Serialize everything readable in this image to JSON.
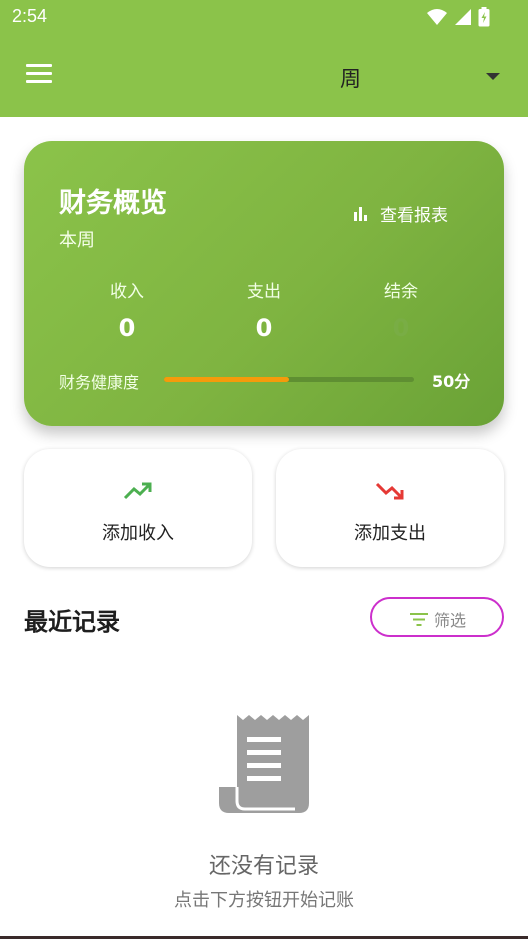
{
  "status_bar": {
    "time": "2:54"
  },
  "app_bar": {
    "period": "周"
  },
  "overview": {
    "title": "财务概览",
    "subtitle": "本周",
    "report_label": "查看报表",
    "stats": [
      {
        "label": "收入",
        "value": "0"
      },
      {
        "label": "支出",
        "value": "0"
      },
      {
        "label": "结余",
        "value": "0"
      }
    ],
    "health_label": "财务健康度",
    "health_score": "50分",
    "health_fraction": 0.5
  },
  "actions": {
    "add_income": "添加收入",
    "add_expense": "添加支出"
  },
  "recent": {
    "title": "最近记录",
    "filter_label": "筛选",
    "empty_title": "还没有记录",
    "empty_subtitle": "点击下方按钮开始记账"
  },
  "colors": {
    "primary": "#8bc34a",
    "income": "#4caf50",
    "expense": "#e53935",
    "health": "#f59b0b",
    "filter_border": "#cc2fcc"
  }
}
